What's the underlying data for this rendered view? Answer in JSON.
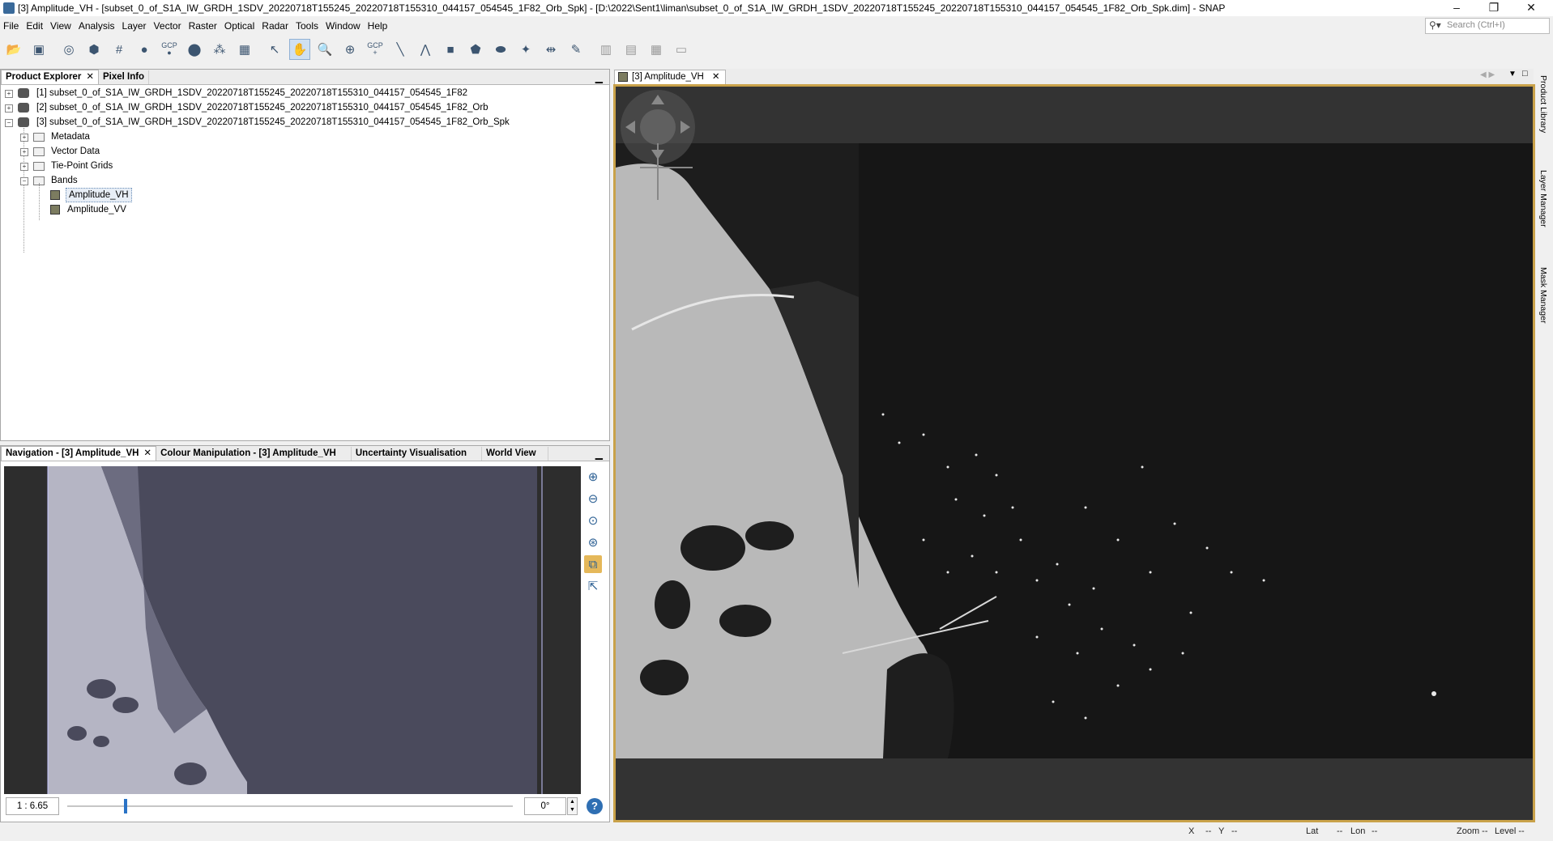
{
  "window": {
    "title": "[3] Amplitude_VH - [subset_0_of_S1A_IW_GRDH_1SDV_20220718T155245_20220718T155310_044157_054545_1F82_Orb_Spk] - [D:\\2022\\Sent1\\liman\\subset_0_of_S1A_IW_GRDH_1SDV_20220718T155245_20220718T155310_044157_054545_1F82_Orb_Spk.dim] - SNAP",
    "minimize": "–",
    "restore": "❐",
    "close": "✕"
  },
  "menu": [
    "File",
    "Edit",
    "View",
    "Analysis",
    "Layer",
    "Vector",
    "Raster",
    "Optical",
    "Radar",
    "Tools",
    "Window",
    "Help"
  ],
  "search": {
    "placeholder": "Search (Ctrl+I)"
  },
  "toolbar": {
    "gcp1": "GCP",
    "gcp2": "GCP"
  },
  "product_explorer": {
    "tabs": [
      "Product Explorer",
      "Pixel Info"
    ],
    "products": [
      "[1] subset_0_of_S1A_IW_GRDH_1SDV_20220718T155245_20220718T155310_044157_054545_1F82",
      "[2] subset_0_of_S1A_IW_GRDH_1SDV_20220718T155245_20220718T155310_044157_054545_1F82_Orb",
      "[3] subset_0_of_S1A_IW_GRDH_1SDV_20220718T155245_20220718T155310_044157_054545_1F82_Orb_Spk"
    ],
    "folders": [
      "Metadata",
      "Vector Data",
      "Tie-Point Grids",
      "Bands"
    ],
    "bands": [
      "Amplitude_VH",
      "Amplitude_VV"
    ]
  },
  "bottom_panel": {
    "tabs": [
      "Navigation - [3] Amplitude_VH",
      "Colour Manipulation - [3] Amplitude_VH",
      "Uncertainty Visualisation",
      "World View"
    ],
    "scale": "1 : 6.65",
    "rotation": "0°",
    "slider_fraction": 0.13
  },
  "image_tab": {
    "label": "[3] Amplitude_VH"
  },
  "side_tabs": [
    "Product Library",
    "Layer Manager",
    "Mask Manager"
  ],
  "status": {
    "x": "X",
    "x_val": "--",
    "y": "Y",
    "y_val": "--",
    "lat": "Lat",
    "lat_val": "--",
    "lon": "Lon",
    "lon_val": "--",
    "zoom": "Zoom --",
    "level": "Level --"
  }
}
